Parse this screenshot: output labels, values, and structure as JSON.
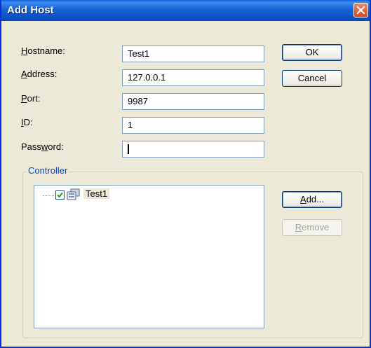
{
  "window": {
    "title": "Add Host"
  },
  "fields": {
    "hostname": {
      "label": "Hostname:",
      "value": "Test1"
    },
    "address": {
      "label": "Address:",
      "value": "127.0.0.1"
    },
    "port": {
      "label": "Port:",
      "value": "9987"
    },
    "id": {
      "label": "ID:",
      "value": "1"
    },
    "password": {
      "label": "Password:",
      "value": ""
    }
  },
  "buttons": {
    "ok": "OK",
    "cancel": "Cancel",
    "add": "Add...",
    "remove": "Remove"
  },
  "controller": {
    "label": "Controller",
    "items": [
      {
        "label": "Test1",
        "checked": true
      }
    ]
  }
}
